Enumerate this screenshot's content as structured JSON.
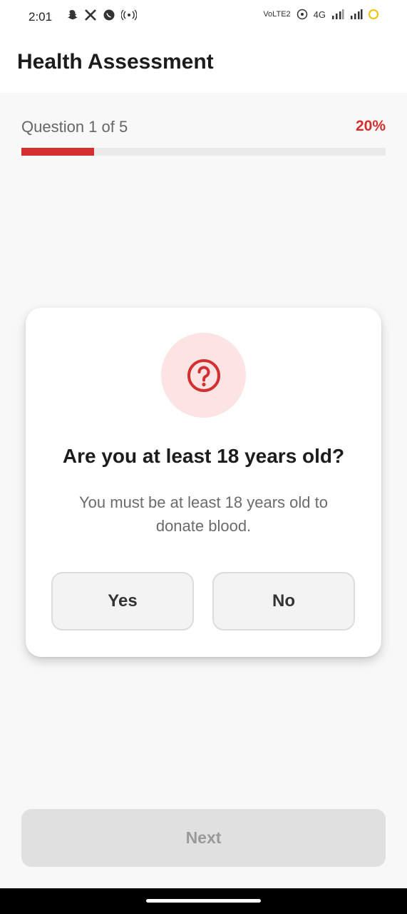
{
  "status_bar": {
    "time": "2:01",
    "left_icons": [
      "snapchat-icon",
      "x-icon",
      "chat-icon",
      "hotspot-icon"
    ],
    "network_badge": "VoLTE2",
    "network_type": "4G",
    "ring_color": "#f2c100"
  },
  "header": {
    "title": "Health Assessment"
  },
  "progress": {
    "label": "Question 1 of 5",
    "percent_label": "20%",
    "value": 0.2,
    "color": "#d32f2f"
  },
  "question": {
    "icon": "question-circle-icon",
    "title": "Are you at least 18 years old?",
    "description": "You must be at least 18 years old to donate blood.",
    "options": {
      "yes": "Yes",
      "no": "No"
    }
  },
  "footer": {
    "next_label": "Next",
    "next_enabled": false
  }
}
